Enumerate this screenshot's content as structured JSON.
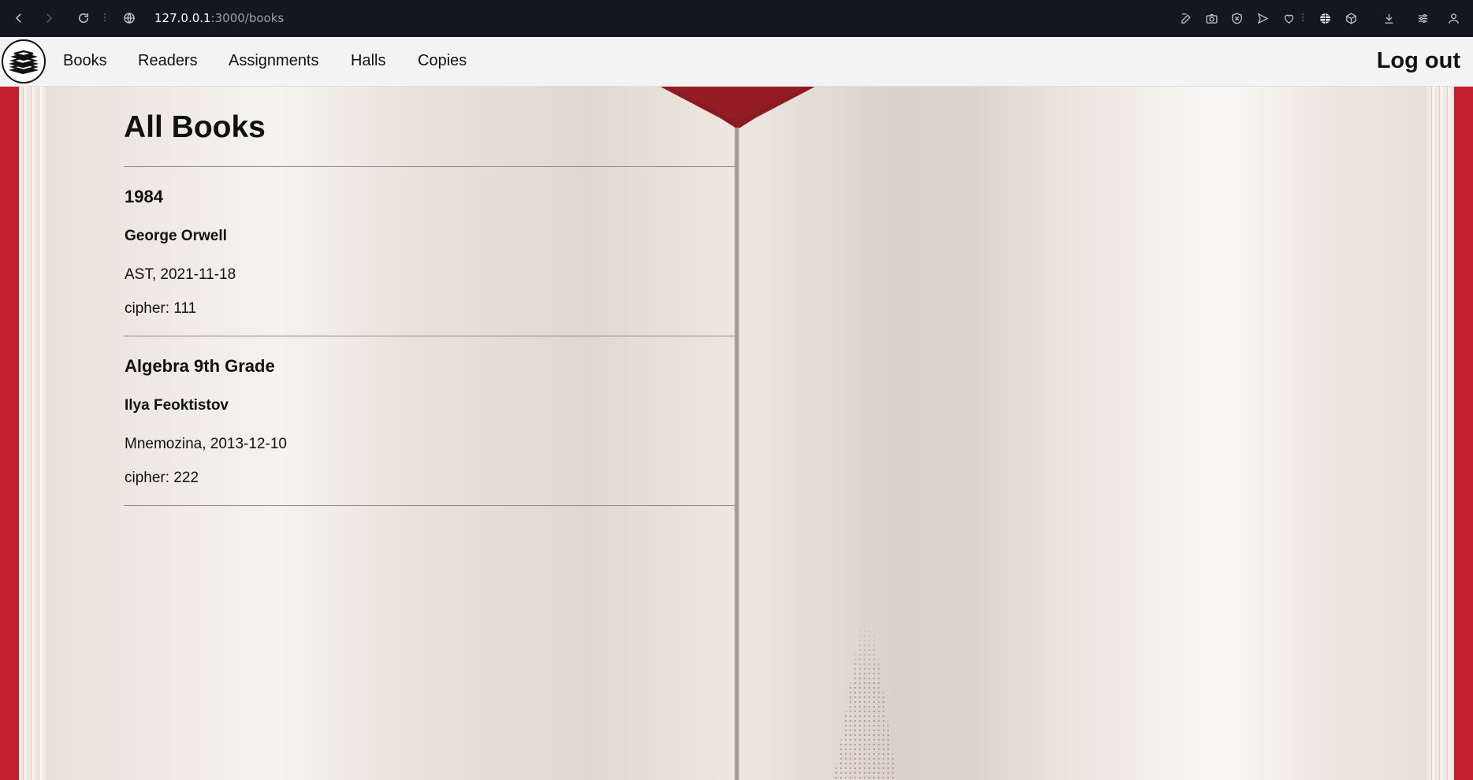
{
  "browser": {
    "url_host": "127.0.0.1",
    "url_path": ":3000/books",
    "icons": [
      "back-icon",
      "forward-icon",
      "reload-icon",
      "site-info-icon",
      "edit-icon",
      "camera-icon",
      "shield-icon",
      "send-icon",
      "heart-icon",
      "globe-icon",
      "cube-icon",
      "download-icon",
      "sliders-icon",
      "profile-icon"
    ]
  },
  "navbar": {
    "links": [
      "Books",
      "Readers",
      "Assignments",
      "Halls",
      "Copies"
    ],
    "logout_label": "Log out"
  },
  "main": {
    "title": "All Books",
    "books": [
      {
        "title": "1984",
        "author": "George Orwell",
        "publication": "AST, 2021-11-18",
        "cipher": "cipher: 111"
      },
      {
        "title": "Algebra 9th Grade",
        "author": "Ilya Feoktistov",
        "publication": "Mnemozina, 2013-12-10",
        "cipher": "cipher: 222"
      }
    ]
  },
  "colors": {
    "cover": "#c2202d",
    "bookmark": "#8b1a22",
    "paper": "#e5ddd3"
  }
}
